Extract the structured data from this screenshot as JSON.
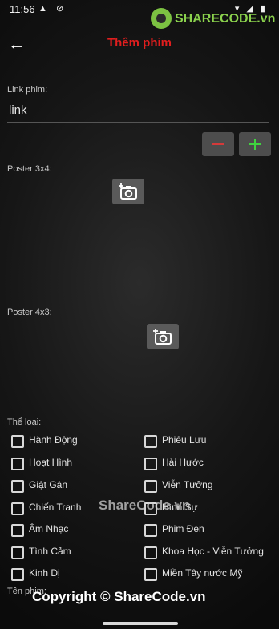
{
  "status": {
    "time": "11:56",
    "icons_left": "▲ ⊘",
    "icons_right": "▾ ◢ ▮"
  },
  "watermark": {
    "logo_text": "SHARECODE.vn",
    "center_text": "ShareCode.vn",
    "footer_text": "Copyright © ShareCode.vn"
  },
  "appbar": {
    "title": "Thêm phim",
    "back_icon": "←"
  },
  "form": {
    "link_label": "Link phim:",
    "link_value": "link",
    "poster34_label": "Poster 3x4:",
    "poster43_label": "Poster 4x3:",
    "genre_label": "Thể loại:",
    "name_label": "Tên phim:"
  },
  "genres_left": [
    "Hành Động",
    "Hoạt Hình",
    "Giật Gân",
    "Chiến Tranh",
    "Âm Nhạc",
    "Tình Cảm",
    "Kinh Dị"
  ],
  "genres_right": [
    "Phiêu Lưu",
    "Hài Hước",
    "Viễn Tưởng",
    "Hình Sự",
    "Phim Đen",
    "Khoa Học - Viễn Tưởng",
    "Miền Tây nước Mỹ"
  ],
  "colors": {
    "title": "#e01e1e",
    "minus": "#d43a3a",
    "plus": "#3fd43f"
  }
}
